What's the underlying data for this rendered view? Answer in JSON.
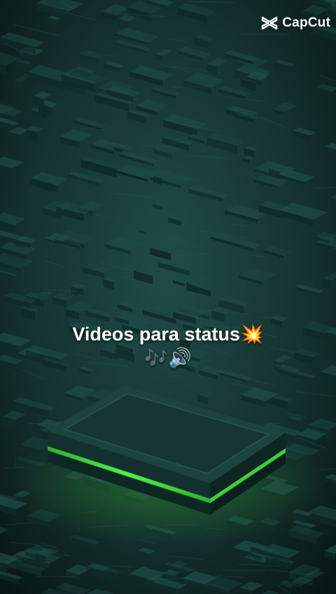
{
  "watermark": {
    "brand": "CapCut",
    "icon": "capcut-logo-icon"
  },
  "caption": {
    "line1": "Videos para status",
    "line1_emoji": "💥",
    "line2_emoji": "🎶🔊"
  },
  "colors": {
    "background": "#0c1f1e",
    "block_top": "#1f4a46",
    "block_side": "#0f2b29",
    "glow": "#3ddc3a"
  }
}
